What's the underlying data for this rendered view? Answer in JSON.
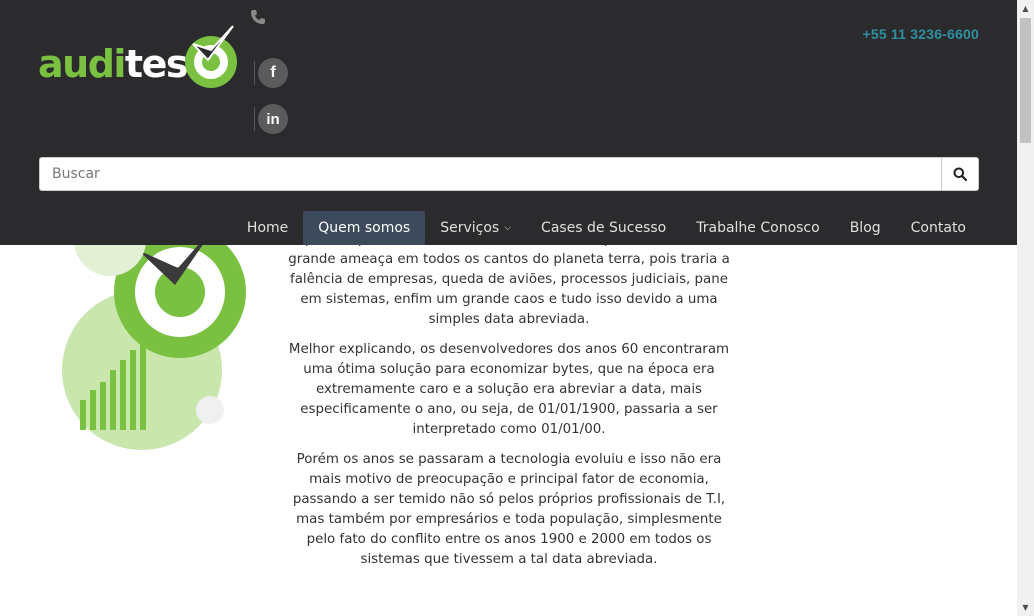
{
  "brand": {
    "name_light": "audi",
    "name_dark": "teste",
    "green": "#7ac142",
    "header_bg": "#2b2b2d"
  },
  "contact": {
    "phone": "+55 11 3236-6600",
    "phone_icon": "phone-icon"
  },
  "social": {
    "facebook_label": "f",
    "linkedin_label": "in"
  },
  "search": {
    "placeholder": "Buscar",
    "value": "",
    "button_icon": "search-icon"
  },
  "nav": {
    "items": [
      {
        "label": "Home"
      },
      {
        "label": "Quem somos",
        "active": true
      },
      {
        "label": "Serviços",
        "dropdown": true
      },
      {
        "label": "Cases de Sucesso"
      },
      {
        "label": "Trabalhe Conosco"
      },
      {
        "label": "Blog"
      },
      {
        "label": "Contato"
      }
    ],
    "active_bg": "#3c4a5c"
  },
  "article": {
    "paragraphs": [
      "pânico, pois a entrada deste novo milênio representava uma grande ameaça em todos os cantos do planeta terra, pois traria a falência de empresas, queda de aviões, processos judiciais, pane em sistemas, enfim um grande caos e tudo isso devido a uma simples data abreviada.",
      "Melhor explicando, os desenvolvedores dos anos 60 encontraram uma ótima solução para economizar bytes, que na época era extremamente caro e a solução era abreviar a data, mais especificamente o ano, ou seja, de 01/01/1900, passaria a ser interpretado como 01/01/00.",
      "Porém os anos se passaram a tecnologia evoluiu e isso não era mais motivo de preocupação e principal fator de economia, passando a ser temido não só pelos próprios profissionais de T.I, mas também por empresários e toda população, simplesmente pelo fato do conflito entre os anos 1900 e 2000 em todos os sistemas que tivessem a tal data abreviada."
    ]
  }
}
